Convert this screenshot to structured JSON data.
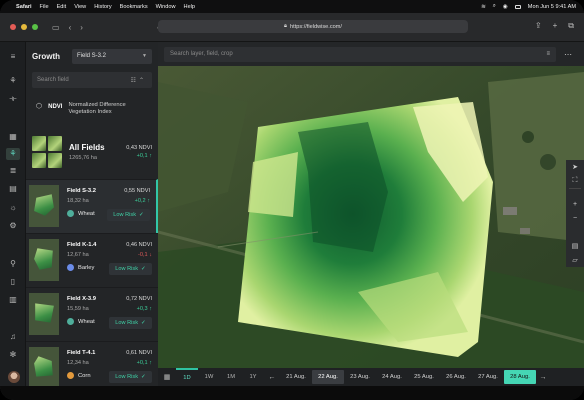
{
  "menubar": {
    "app": "Safari",
    "items": [
      "File",
      "Edit",
      "View",
      "History",
      "Bookmarks",
      "Window",
      "Help"
    ],
    "datetime": "Mon Jun 5  9:41 AM"
  },
  "browser": {
    "url": "https://fieldwise.com/"
  },
  "panel": {
    "title": "Growth",
    "field_select": "Field S-3.2",
    "search_placeholder": "Search field",
    "index_badge": "NDVI",
    "index_desc": "Normalized Difference Vegetation Index",
    "all_fields": {
      "label": "All Fields",
      "area": "1265,76 ha",
      "value": "0,43 NDVI",
      "delta": "+0,1 ↑"
    }
  },
  "fields": [
    {
      "name": "Field S-3.2",
      "area": "18,32 ha",
      "crop": "Wheat",
      "crop_color": "#4fae9b",
      "ndvi": "0,55 NDVI",
      "delta": "+0,2 ↑",
      "trend": "up",
      "risk": "Low Risk",
      "selected": true
    },
    {
      "name": "Field K-1.4",
      "area": "12,67 ha",
      "crop": "Barley",
      "crop_color": "#6b8ce8",
      "ndvi": "0,46 NDVI",
      "delta": "-0,1 ↓",
      "trend": "down",
      "risk": "Low Risk",
      "selected": false
    },
    {
      "name": "Field X-3.9",
      "area": "15,59 ha",
      "crop": "Wheat",
      "crop_color": "#4fae9b",
      "ndvi": "0,72 NDVI",
      "delta": "+0,3 ↑",
      "trend": "up",
      "risk": "Low Risk",
      "selected": false
    },
    {
      "name": "Field T-4.1",
      "area": "12,34 ha",
      "crop": "Corn",
      "crop_color": "#e39a3c",
      "ndvi": "0,61 NDVI",
      "delta": "+0,1 ↑",
      "trend": "up",
      "risk": "Low Risk",
      "selected": false
    }
  ],
  "map": {
    "search_placeholder": "Search layer, field, crop"
  },
  "timeline": {
    "ranges": [
      "1D",
      "1W",
      "1M",
      "1Y"
    ],
    "active_range": "1D",
    "dates": [
      "21 Aug.",
      "22 Aug.",
      "23 Aug.",
      "24 Aug.",
      "25 Aug.",
      "26 Aug.",
      "27 Aug.",
      "28 Aug."
    ],
    "compare_date": "22 Aug.",
    "selected_date": "28 Aug."
  }
}
